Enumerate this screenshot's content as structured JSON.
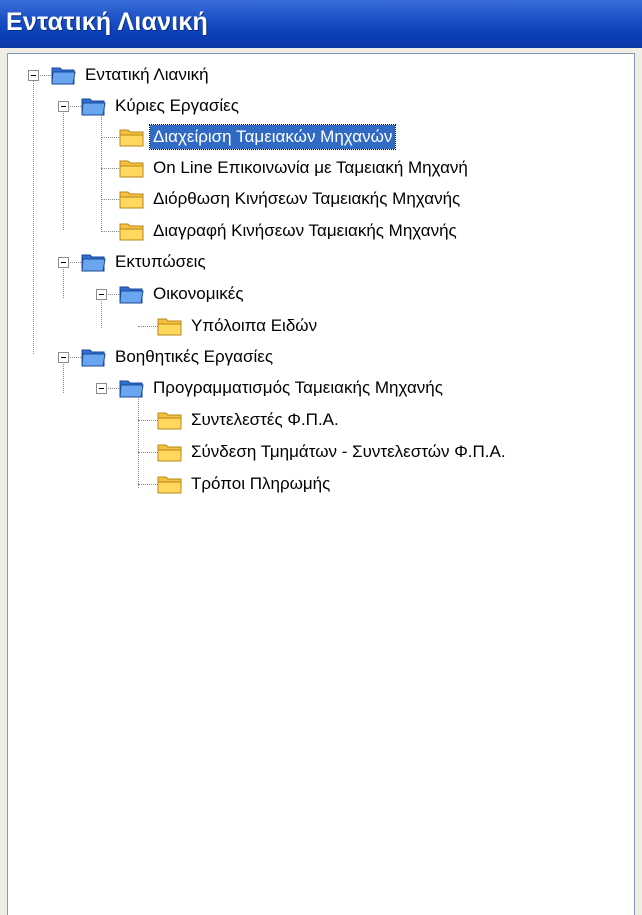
{
  "window": {
    "title": "Εντατική Λιανική"
  },
  "tree": {
    "root": {
      "label": "Εντατική Λιανική"
    },
    "main": {
      "label": "Κύριες Εργασίες",
      "items": [
        "Διαχείριση Ταμειακών Μηχανών",
        "On Line Επικοινωνία με Ταμειακή Μηχανή",
        "Διόρθωση Κινήσεων Ταμειακής Μηχανής",
        "Διαγραφή Κινήσεων Ταμειακής Μηχανής"
      ]
    },
    "prints": {
      "label": "Εκτυπώσεις",
      "financial": {
        "label": "Οικονομικές",
        "items": [
          "Υπόλοιπα Ειδών"
        ]
      }
    },
    "aux": {
      "label": "Βοηθητικές Εργασίες",
      "programming": {
        "label": "Προγραμματισμός Ταμειακής Μηχανής",
        "items": [
          "Συντελεστές Φ.Π.Α.",
          "Σύνδεση Τμημάτων - Συντελεστών Φ.Π.Α.",
          "Τρόποι Πληρωμής"
        ]
      }
    }
  },
  "selected_item": "Διαχείριση Ταμειακών Μηχανών",
  "colors": {
    "titlebar": "#0a3fb8",
    "selection": "#316ac5",
    "folder_blue": "#3b7bd6",
    "folder_yellow": "#f4c23c"
  }
}
